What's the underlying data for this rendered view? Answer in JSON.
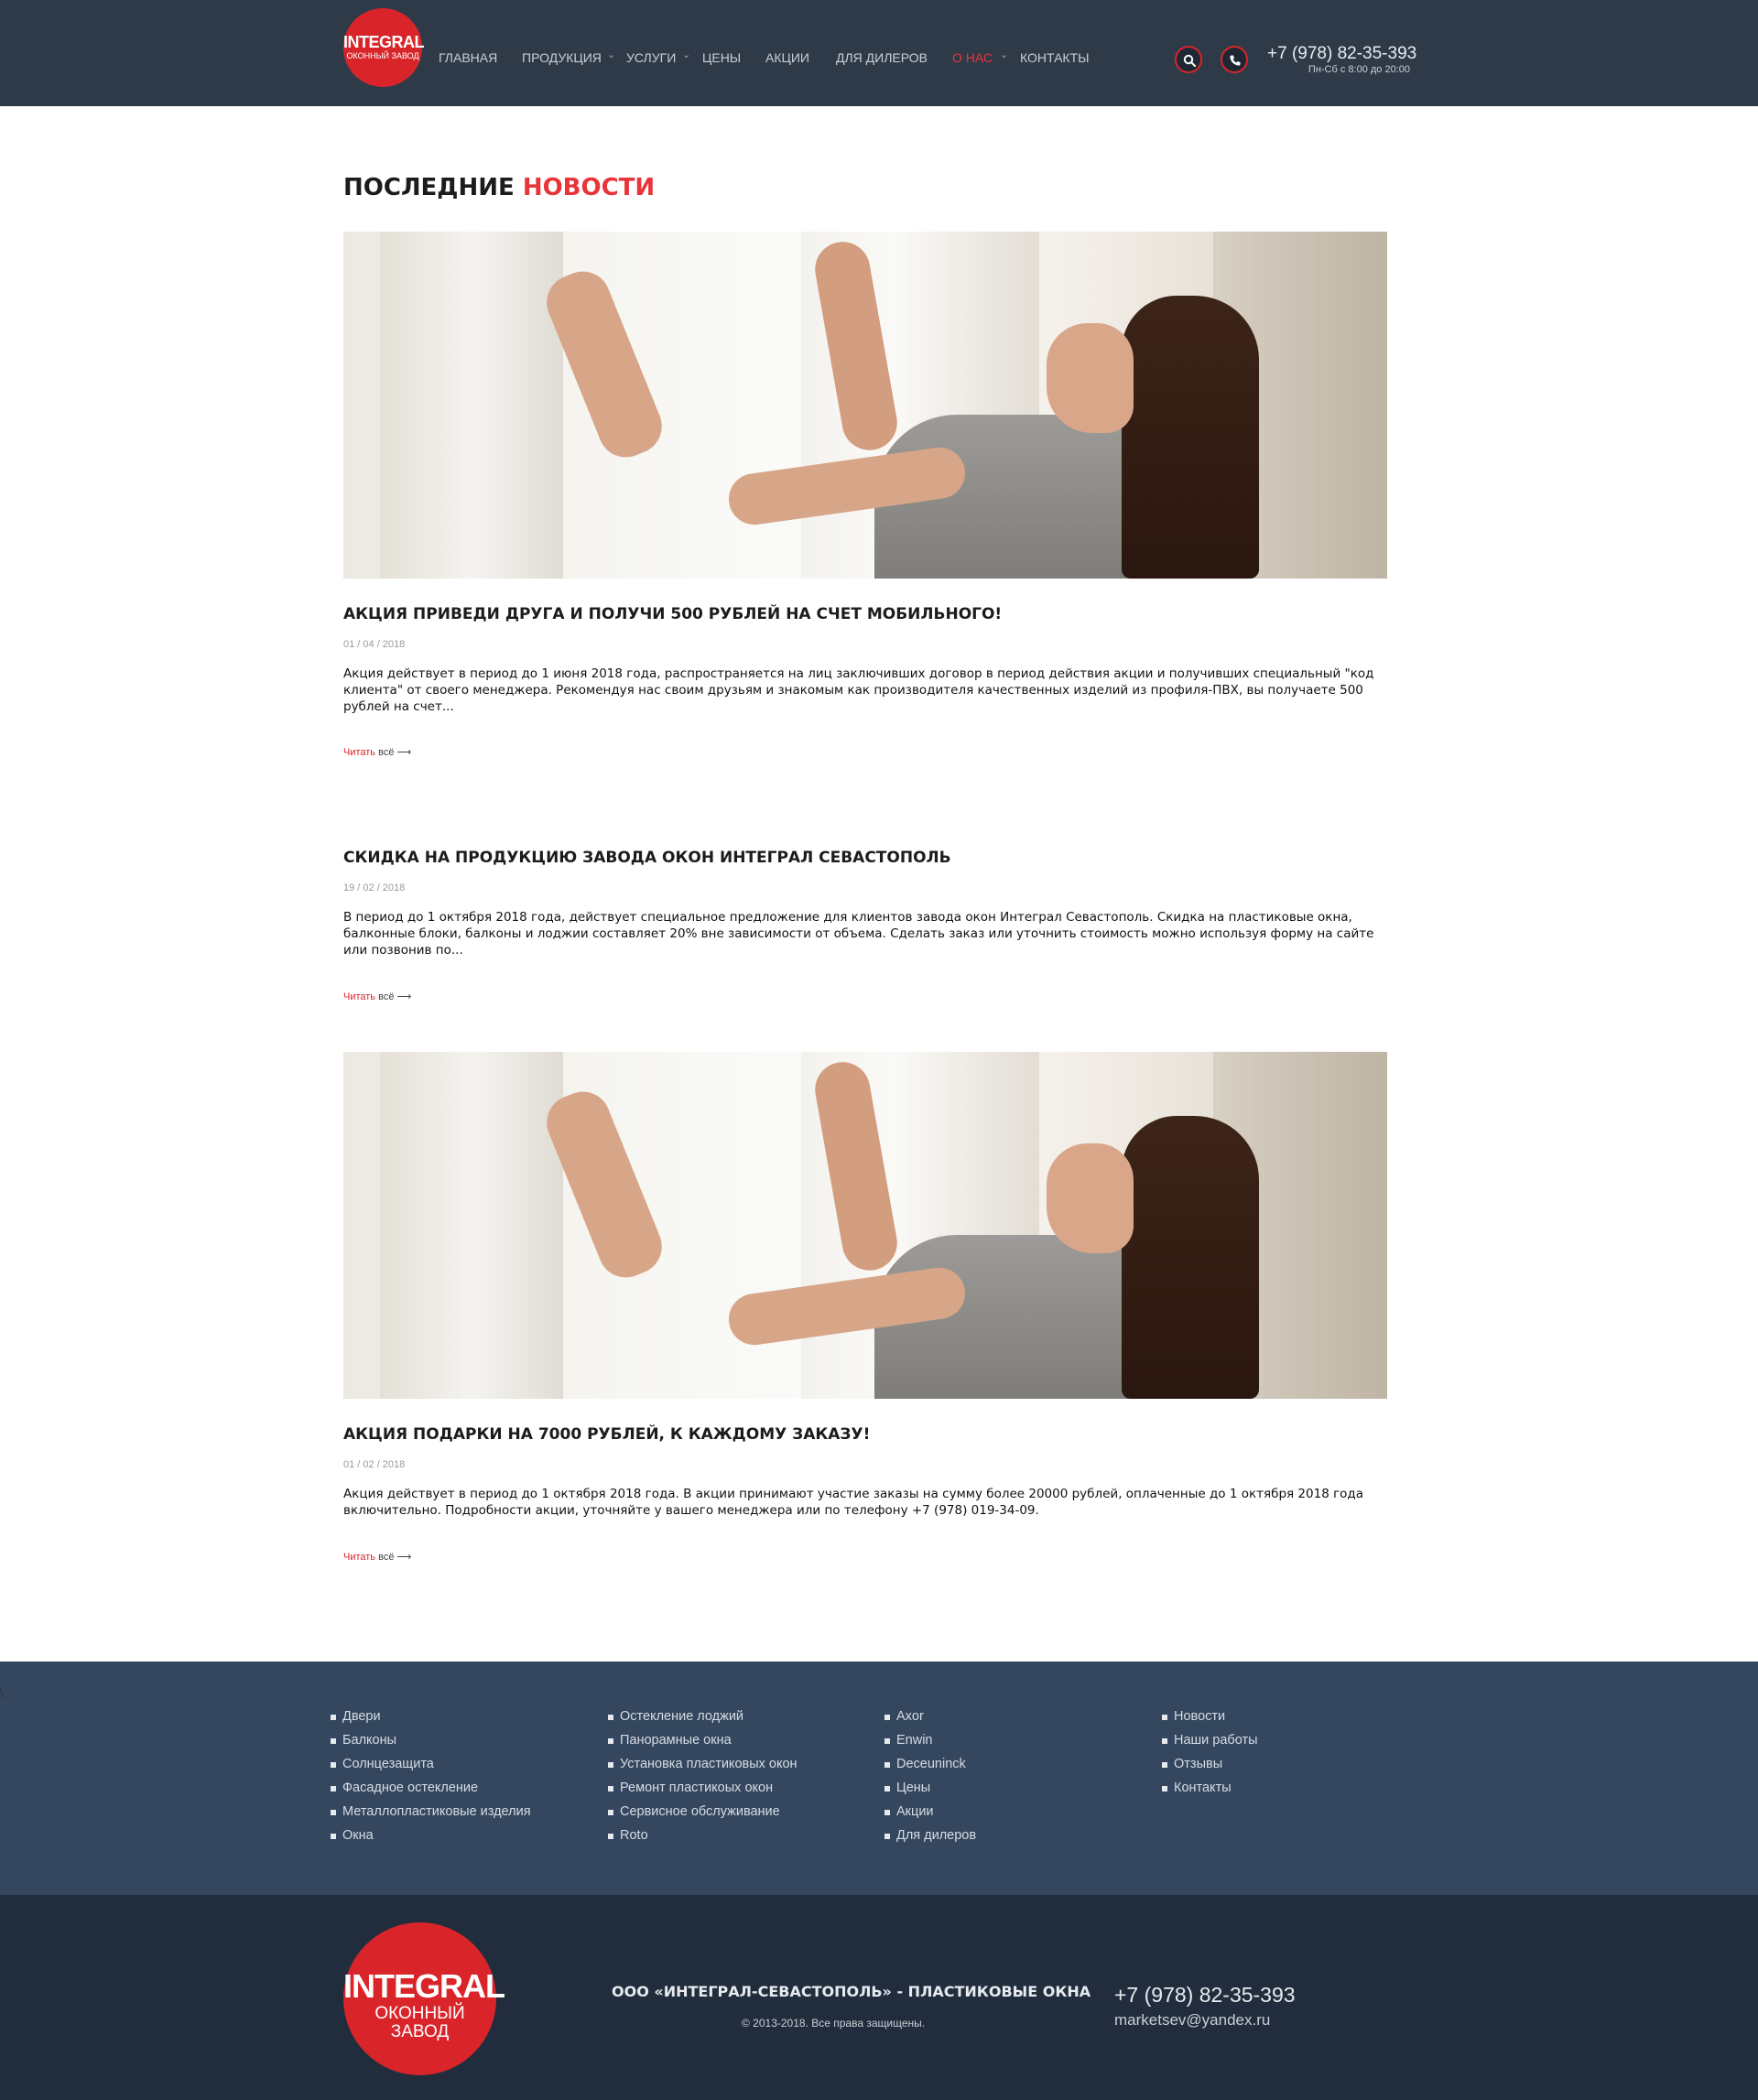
{
  "header": {
    "logo": {
      "line1": "INTEGRAL",
      "line2": "ОКОННЫЙ ЗАВОД"
    },
    "nav": [
      {
        "label": "ГЛАВНАЯ"
      },
      {
        "label": "ПРОДУКЦИЯ"
      },
      {
        "label": "УСЛУГИ"
      },
      {
        "label": "ЦЕНЫ"
      },
      {
        "label": "АКЦИИ"
      },
      {
        "label": "ДЛЯ ДИЛЕРОВ"
      },
      {
        "label": "О НАС"
      },
      {
        "label": "КОНТАКТЫ"
      }
    ],
    "phone": "+7 (978) 82-35-393",
    "hours": "Пн-Сб с 8:00 до 20:00",
    "icons": [
      "search-icon",
      "phone-icon"
    ],
    "colors": {
      "bar": "#2f3a49",
      "accent": "#e8353a"
    }
  },
  "main": {
    "title_part1": "ПОСЛЕДНИЕ",
    "title_part2": "НОВОСТИ",
    "news": [
      {
        "title": "АКЦИЯ ПРИВЕДИ ДРУГА И ПОЛУЧИ 500 РУБЛЕЙ НА СЧЕТ МОБИЛЬНОГО!",
        "date": "01 / 04 / 2018",
        "text": "Акция действует в период до 1 июня 2018 года, распространяется на лиц заключивших договор в период действия акции и получивших специальный \"код клиента\" от своего менеджера. Рекомендуя нас своим друзьям и знакомым как производителя качественных изделий из профиля-ПВХ, вы получаете 500 рублей на счет...",
        "read_part1": "Читать",
        "read_part2": "всё"
      },
      {
        "title": "СКИДКА НА ПРОДУКЦИЮ ЗАВОДА ОКОН ИНТЕГРАЛ СЕВАСТОПОЛЬ",
        "date": "19 / 02 / 2018",
        "text": "В период до 1 октября 2018 года, действует специальное предложение для клиентов завода окон Интеграл Севастополь. Скидка на пластиковые окна, балконные блоки, балконы и лоджии составляет 20% вне зависимости от объема. Сделать заказ или уточнить стоимость можно используя форму на сайте или позвонив по...",
        "read_part1": "Читать",
        "read_part2": "всё"
      },
      {
        "title": "АКЦИЯ ПОДАРКИ НА 7000 РУБЛЕЙ, К КАЖДОМУ ЗАКАЗУ!",
        "date": "01 / 02 / 2018",
        "text": "Акция действует в период до 1 октября 2018 года. В акции принимают участие заказы на сумму более 20000 рублей, оплаченные до 1 октября 2018 года включительно.  Подробности акции, уточняйте у вашего менеджера или по телефону +7 (978) 019-34-09.",
        "read_part1": "Читать",
        "read_part2": "всё"
      }
    ]
  },
  "stray_char": "\\",
  "footer_links": {
    "col1": [
      "Двери",
      "Балконы",
      "Солнцезащита",
      "Фасадное остекление",
      "Металлопластиковые изделия",
      "Окна"
    ],
    "col2": [
      "Остекление лоджий",
      "Панорамные окна",
      "Установка пластиковых окон",
      "Ремонт пластикоых окон",
      "Сервисное обслуживание",
      "Roto"
    ],
    "col3": [
      "Axor",
      "Enwin",
      "Deceuninck",
      "Цены",
      "Акции",
      "Для дилеров"
    ],
    "col4": [
      "Новости",
      "Наши работы",
      "Отзывы",
      "Контакты"
    ]
  },
  "footer": {
    "logo": {
      "line1": "INTEGRAL",
      "line2": "ОКОННЫЙ ЗАВОД"
    },
    "company": "ООО «ИНТЕГРАЛ-СЕВАСТОПОЛЬ» - ПЛАСТИКОВЫЕ ОКНА",
    "copyright": "© 2013-2018. Все права защищены.",
    "phone": "+7 (978) 82-35-393",
    "email": "marketsev@yandex.ru"
  }
}
